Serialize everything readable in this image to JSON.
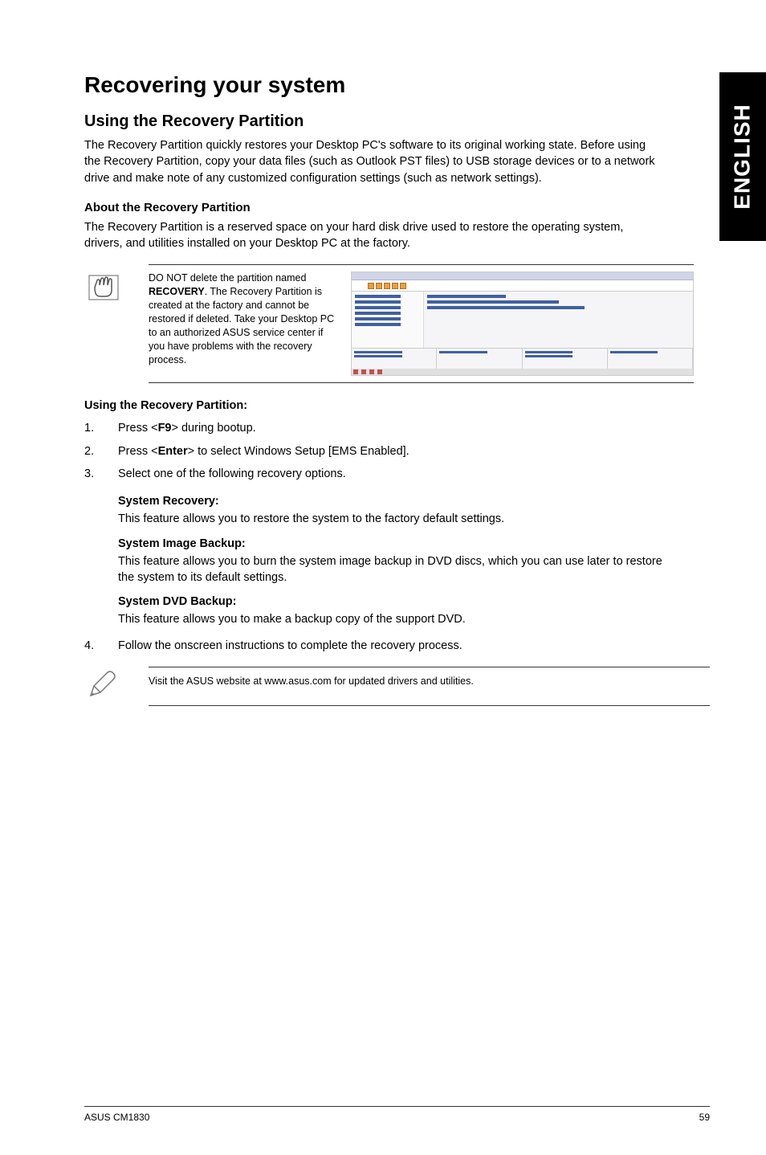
{
  "side_tab": "ENGLISH",
  "h1": "Recovering your system",
  "h2": "Using the Recovery Partition",
  "intro": "The Recovery Partition quickly restores your Desktop PC's software to its original working state. Before using the Recovery Partition, copy your data files (such as Outlook PST files) to USB storage devices or to a network drive and make note of any customized configuration settings (such as network settings).",
  "h3": "About the Recovery Partition",
  "about_para": "The Recovery Partition is a reserved space on your hard disk drive used to restore the operating system, drivers, and utilities installed on your Desktop PC at the factory.",
  "warning_note_pre": "DO NOT delete the partition named ",
  "warning_note_bold": "RECOVERY",
  "warning_note_post": ". The Recovery Partition is created at the factory and cannot be restored if deleted. Take your Desktop PC to an authorized ASUS service center if you have problems with the recovery process.",
  "using_title": "Using the Recovery Partition:",
  "steps": [
    {
      "num": "1.",
      "pre": "Press <",
      "bold": "F9",
      "post": "> during bootup."
    },
    {
      "num": "2.",
      "pre": "Press <",
      "bold": "Enter",
      "post": "> to select Windows Setup [EMS Enabled]."
    },
    {
      "num": "3.",
      "pre": "",
      "bold": "",
      "post": "Select one of the following recovery options."
    }
  ],
  "options": [
    {
      "title": "System Recovery:",
      "body": "This feature allows you to restore the system to the factory default settings."
    },
    {
      "title": "System Image Backup:",
      "body": "This feature allows you to burn the system image backup in DVD discs, which you can use later to restore the system to its default settings."
    },
    {
      "title": "System DVD Backup:",
      "body": "This feature allows you to make a backup copy of the support DVD."
    }
  ],
  "step4": {
    "num": "4.",
    "body": "Follow the onscreen instructions to complete the recovery process."
  },
  "tip": "Visit the ASUS website at www.asus.com for updated drivers and utilities.",
  "footer_left": "ASUS CM1830",
  "footer_right": "59"
}
